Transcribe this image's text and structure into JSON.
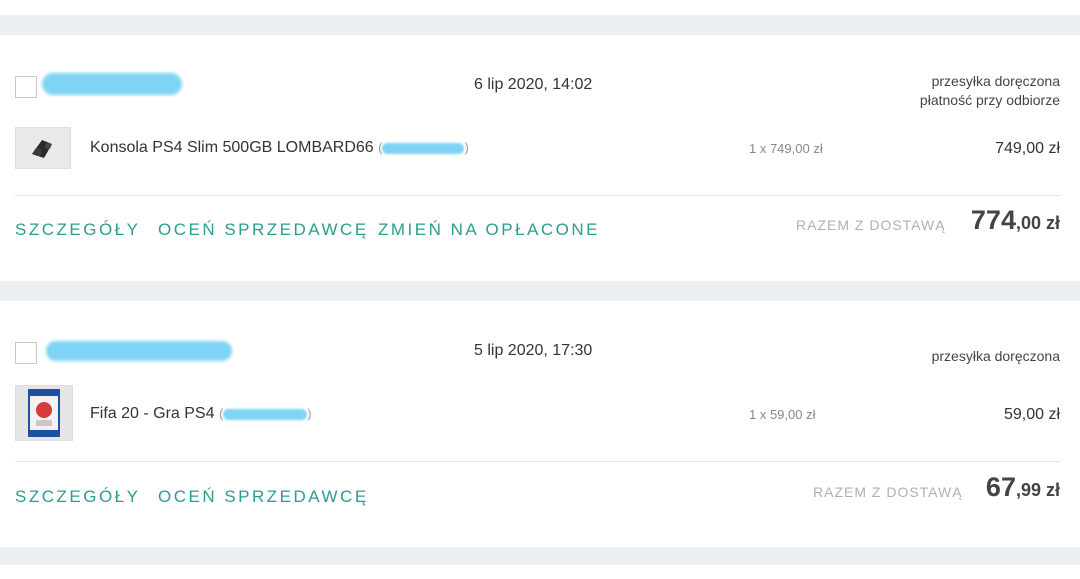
{
  "orders": [
    {
      "date": "6 lip 2020, 14:02",
      "status_lines": [
        "przesyłka doręczona",
        "płatność przy odbiorze"
      ],
      "item": {
        "title": "Konsola PS4 Slim 500GB LOMBARD66",
        "offer_id_open": "(",
        "offer_id_close": ")",
        "quantity_text": "1 x 749,00 zł",
        "price": "749,00 zł",
        "thumbnail_icon": "ps4-console-icon"
      },
      "actions": [
        "SZCZEGÓŁY",
        "OCEŃ SPRZEDAWCĘ",
        "ZMIEŃ NA OPŁACONE"
      ],
      "total_label": "RAZEM Z DOSTAWĄ",
      "total_int": "774",
      "total_dec": ",00 zł"
    },
    {
      "date": "5 lip 2020, 17:30",
      "status_lines": [
        "przesyłka doręczona"
      ],
      "item": {
        "title": "Fifa 20 - Gra PS4",
        "offer_id_open": "(",
        "offer_id_close": ")",
        "quantity_text": "1 x 59,00 zł",
        "price": "59,00 zł",
        "thumbnail_icon": "game-box-icon"
      },
      "actions": [
        "SZCZEGÓŁY",
        "OCEŃ SPRZEDAWCĘ"
      ],
      "total_label": "RAZEM Z DOSTAWĄ",
      "total_int": "67",
      "total_dec": ",99 zł"
    }
  ],
  "colors": {
    "accent": "#2a9d8f",
    "background": "#eceff1",
    "redaction": "#7fd3f5"
  }
}
